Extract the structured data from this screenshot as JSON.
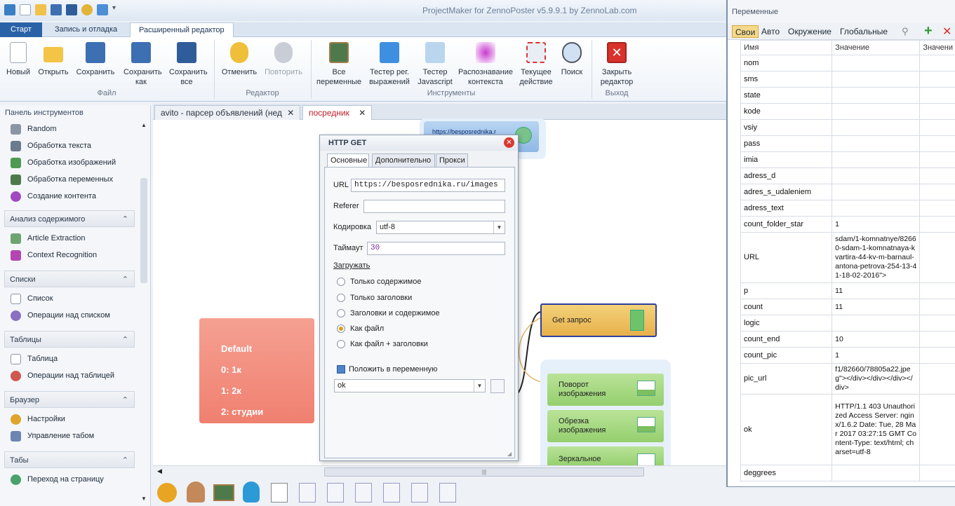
{
  "window": {
    "title": "ProjectMaker for ZennoPoster v5.9.9.1 by ZennoLab.com"
  },
  "ribbon_tabs": [
    {
      "label": "Старт"
    },
    {
      "label": "Запись и отладка"
    },
    {
      "label": "Расширенный редактор"
    }
  ],
  "ribbon": {
    "file_buttons": [
      {
        "label": "Новый"
      },
      {
        "label": "Открыть"
      },
      {
        "label": "Сохранить"
      },
      {
        "label": "Сохранить как"
      },
      {
        "label": "Сохранить все"
      }
    ],
    "file_group": "Файл",
    "editor_buttons": [
      {
        "label": "Отменить"
      },
      {
        "label": "Повторить"
      }
    ],
    "editor_group": "Редактор",
    "tools_buttons": [
      {
        "label": "Все переменные"
      },
      {
        "label": "Тестер рег. выражений"
      },
      {
        "label": "Тестер Javascript"
      },
      {
        "label": "Распознавание контекста"
      },
      {
        "label": "Текущее действие"
      },
      {
        "label": "Поиск"
      }
    ],
    "tools_group": "Инструменты",
    "exit_buttons": [
      {
        "label": "Закрыть редактор"
      }
    ],
    "exit_group": "Выход"
  },
  "toolbox": {
    "title": "Панель инструментов",
    "top_items": [
      "Random",
      "Обработка текста",
      "Обработка изображений",
      "Обработка переменных",
      "Создание контента"
    ],
    "sections": [
      {
        "title": "Анализ содержимого",
        "items": [
          "Article Extraction",
          "Context Recognition"
        ]
      },
      {
        "title": "Списки",
        "items": [
          "Список",
          "Операции над списком"
        ]
      },
      {
        "title": "Таблицы",
        "items": [
          "Таблица",
          "Операции над таблицей"
        ]
      },
      {
        "title": "Браузер",
        "items": [
          "Настройки",
          "Управление табом"
        ]
      },
      {
        "title": "Табы",
        "items": [
          "Переход на страницу"
        ]
      }
    ]
  },
  "doc_tabs": [
    {
      "label": "avito - парсер объявлений (нед"
    },
    {
      "label": "посредник"
    }
  ],
  "canvas": {
    "url_block": "https://besposrednika.r",
    "default_block": {
      "title": "Default",
      "lines": [
        "0: 1к",
        "1: 2к",
        "2: студии"
      ]
    },
    "get_block": "Get запрос",
    "image_blocks": [
      "Поворот изображения",
      "Обрезка изображения",
      "Зеркальное"
    ]
  },
  "dialog": {
    "title": "HTTP GET",
    "tabs": [
      "Основные",
      "Дополнительно",
      "Прокси"
    ],
    "url_label": "URL",
    "url_value": "https://besposrednika.ru/images",
    "referer_label": "Referer",
    "referer_value": "",
    "encoding_label": "Кодировка",
    "encoding_value": "utf-8",
    "timeout_label": "Таймаут",
    "timeout_value": "30",
    "load_label": "Загружать",
    "load_options": [
      "Только содержимое",
      "Только заголовки",
      "Заголовки и содержимое",
      "Как файл",
      "Как файл + заголовки"
    ],
    "load_selected": 3,
    "save_to_var_label": "Положить в переменную",
    "var_value": "ok"
  },
  "variables_panel": {
    "title": "Переменные",
    "tabs": [
      "Свои",
      "Авто",
      "Окружение",
      "Глобальные"
    ],
    "columns": [
      "Имя",
      "Значение",
      "Значени"
    ],
    "rows": [
      {
        "name": "nom",
        "value": ""
      },
      {
        "name": "sms",
        "value": ""
      },
      {
        "name": "state",
        "value": ""
      },
      {
        "name": "kode",
        "value": ""
      },
      {
        "name": "vsiy",
        "value": ""
      },
      {
        "name": "pass",
        "value": ""
      },
      {
        "name": "imia",
        "value": ""
      },
      {
        "name": "adress_d",
        "value": ""
      },
      {
        "name": "adres_s_udaleniem",
        "value": ""
      },
      {
        "name": "adress_text",
        "value": ""
      },
      {
        "name": "count_folder_star",
        "value": "1"
      },
      {
        "name": "URL",
        "value": "sdam/1-komnatnye/82660-sdam-1-komnatnaya-kvartira-44-kv-m-barnaul-antona-petrova-254-13-41-18-02-2016\">"
      },
      {
        "name": "p",
        "value": "11"
      },
      {
        "name": "count",
        "value": "11"
      },
      {
        "name": "logic",
        "value": ""
      },
      {
        "name": "count_end",
        "value": "10"
      },
      {
        "name": "count_pic",
        "value": "1"
      },
      {
        "name": "pic_url",
        "value": "f1/82660/78805a22.jpeg\"></div></div></div></div>"
      },
      {
        "name": "ok",
        "value": "HTTP/1.1 403 Unauthorized Access Server: nginx/1.6.2 Date: Tue, 28 Mar 2017 03:27:15 GMT Content-Type: text/html; charset=utf-8"
      },
      {
        "name": "deggrees",
        "value": ""
      }
    ]
  }
}
